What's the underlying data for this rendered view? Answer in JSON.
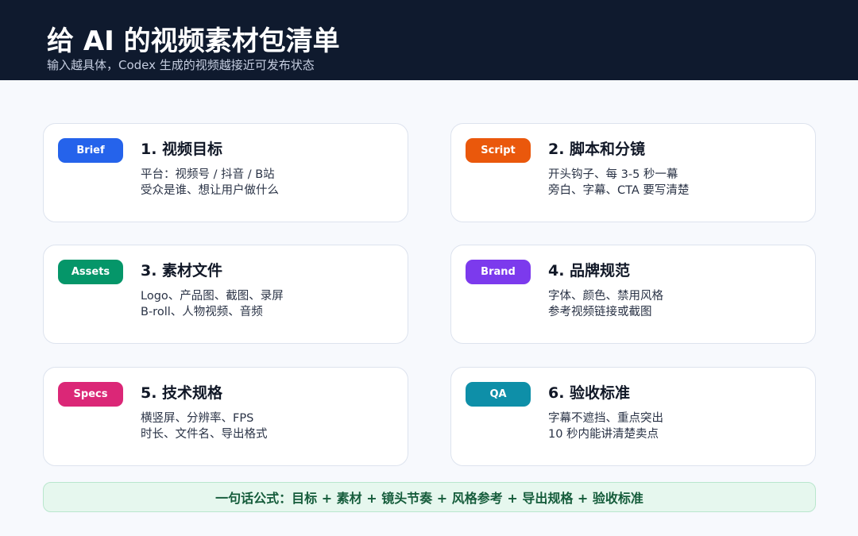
{
  "header": {
    "title": "给 AI 的视频素材包清单",
    "subtitle": "输入越具体，Codex 生成的视频越接近可发布状态"
  },
  "cards": [
    {
      "badge": "Brief",
      "badge_color": "#2563eb",
      "title": "1. 视频目标",
      "line1": "平台：视频号 / 抖音 / B站",
      "line2": "受众是谁、想让用户做什么"
    },
    {
      "badge": "Script",
      "badge_color": "#ea580c",
      "title": "2. 脚本和分镜",
      "line1": "开头钩子、每 3-5 秒一幕",
      "line2": "旁白、字幕、CTA 要写清楚"
    },
    {
      "badge": "Assets",
      "badge_color": "#059669",
      "title": "3. 素材文件",
      "line1": "Logo、产品图、截图、录屏",
      "line2": "B-roll、人物视频、音频"
    },
    {
      "badge": "Brand",
      "badge_color": "#7c3aed",
      "title": "4. 品牌规范",
      "line1": "字体、颜色、禁用风格",
      "line2": "参考视频链接或截图"
    },
    {
      "badge": "Specs",
      "badge_color": "#db2777",
      "title": "5. 技术规格",
      "line1": "横竖屏、分辨率、FPS",
      "line2": "时长、文件名、导出格式"
    },
    {
      "badge": "QA",
      "badge_color": "#0e8fa8",
      "title": "6. 验收标准",
      "line1": "字幕不遮挡、重点突出",
      "line2": "10 秒内能讲清楚卖点"
    }
  ],
  "formula": "一句话公式：目标 + 素材 + 镜头节奏 + 风格参考 + 导出规格 + 验收标准"
}
